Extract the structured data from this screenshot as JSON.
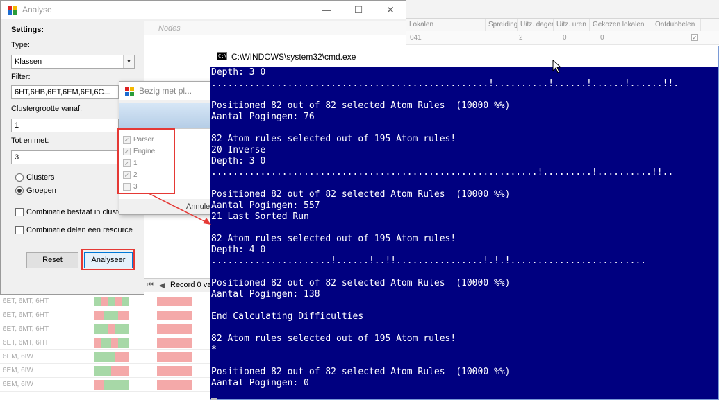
{
  "background": {
    "columns": [
      "Lokalen",
      "Spreiding",
      "Uitz. dagen",
      "Uitz. uren",
      "Gekozen lokalen",
      "Ontdubbelen"
    ],
    "row1": {
      "code": "041",
      "spreiding": "2",
      "uitz_dagen": "0",
      "uitz_uren": "0"
    },
    "rows": [
      {
        "text": "6ET, 6MT, 6HT"
      },
      {
        "text": "6ET, 6MT, 6HT"
      },
      {
        "text": "6ET, 6MT, 6HT"
      },
      {
        "text": "6ET, 6MT, 6HT"
      },
      {
        "text": "6EM, 6IW"
      },
      {
        "text": "6EM, 6IW"
      },
      {
        "text": "6EM, 6IW"
      }
    ]
  },
  "analyse": {
    "title": "Analyse",
    "settings_label": "Settings:",
    "type_label": "Type:",
    "type_value": "Klassen",
    "filter_label": "Filter:",
    "filter_value": "6HT,6HB,6ET,6EM,6EI,6C...",
    "cluster_from_label": "Clustergrootte vanaf:",
    "cluster_from_value": "1",
    "cluster_to_label": "Tot en met:",
    "cluster_to_value": "3",
    "radio_clusters": "Clusters",
    "radio_groepen": "Groepen",
    "check_cluster": "Combinatie bestaat in cluster",
    "check_resource": "Combinatie delen een resource",
    "reset_button": "Reset",
    "analyse_button": "Analyseer",
    "nodes_header": "Nodes",
    "record_label": "Record 0 va"
  },
  "bezig": {
    "title": "Bezig met pl...",
    "items": [
      {
        "label": "Parser",
        "checked": "✓"
      },
      {
        "label": "Engine",
        "checked": "✓"
      },
      {
        "label": "1",
        "checked": "✓"
      },
      {
        "label": "2",
        "checked": "✓"
      },
      {
        "label": "3",
        "checked": ""
      }
    ],
    "cancel_button": "Annule"
  },
  "cmd": {
    "title": "C:\\WINDOWS\\system32\\cmd.exe",
    "lines": [
      "Depth: 3 0",
      "...................................................!..........!......!......!......!!.",
      "",
      "Positioned 82 out of 82 selected Atom Rules  (10000 %%)",
      "Aantal Pogingen: 76",
      "",
      "82 Atom rules selected out of 195 Atom rules!",
      "20 Inverse",
      "Depth: 3 0",
      "............................................................!.........!..........!!..",
      "",
      "Positioned 82 out of 82 selected Atom Rules  (10000 %%)",
      "Aantal Pogingen: 557",
      "21 Last Sorted Run",
      "",
      "82 Atom rules selected out of 195 Atom rules!",
      "Depth: 4 0",
      "......................!......!..!!................!.!.!.........................",
      "",
      "Positioned 82 out of 82 selected Atom Rules  (10000 %%)",
      "Aantal Pogingen: 138",
      "",
      "End Calculating Difficulties",
      "",
      "82 Atom rules selected out of 195 Atom rules!",
      "*",
      "",
      "Positioned 82 out of 82 selected Atom Rules  (10000 %%)",
      "Aantal Pogingen: 0"
    ]
  },
  "colors": {
    "cmd_bg": "#000080",
    "highlight": "#e53935"
  }
}
